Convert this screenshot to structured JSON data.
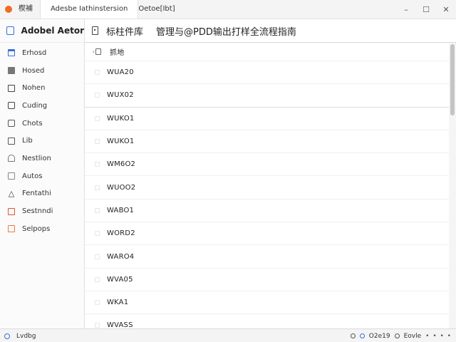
{
  "titlebar": {
    "tab_active": "楔補",
    "tab_2": "Adesbe Iathinstersion",
    "tab_3": "Oetoe[Ibt]",
    "minimize": "–",
    "maximize": "☐",
    "close": "✕"
  },
  "sidebar": {
    "title": "Adobel Aetor",
    "items": [
      {
        "label": "Erhosd",
        "icon": "calendar-icon"
      },
      {
        "label": "Hosed",
        "icon": "square-filled-icon"
      },
      {
        "label": "Nohen",
        "icon": "square-icon"
      },
      {
        "label": "Cuding",
        "icon": "image-icon"
      },
      {
        "label": "Chots",
        "icon": "clock-icon"
      },
      {
        "label": "Lib",
        "icon": "document-icon"
      },
      {
        "label": "Nestlion",
        "icon": "bell-icon"
      },
      {
        "label": "Autos",
        "icon": "box-icon"
      },
      {
        "label": "Fentathi",
        "icon": "triangle-icon"
      },
      {
        "label": "Sestnndi",
        "icon": "orange-doc-icon"
      },
      {
        "label": "Selpops",
        "icon": "orange-box-icon"
      }
    ]
  },
  "main": {
    "title": "标柱件库",
    "subtitle": "管理与@PDD输出打样全流程指南",
    "header_row": "抓地",
    "rows": [
      "WUA20",
      "WUX02",
      "WUKO1",
      "WUKO1",
      "WM6O2",
      "WUOO2",
      "WABO1",
      "WORD2",
      "WARO4",
      "WVA05",
      "WKA1",
      "WVASS"
    ]
  },
  "statusbar": {
    "left_text": "Lvdbg",
    "right_version": "O2e19",
    "right_label": "Eovle",
    "right_dots": "• • • •"
  },
  "colors": {
    "accent": "#3a6fd8",
    "brand_orange": "#f26b21"
  }
}
